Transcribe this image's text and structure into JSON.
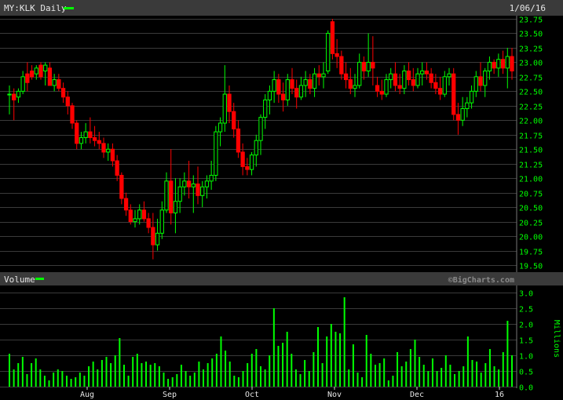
{
  "header": {
    "symbol_label": "MY:KLK Daily",
    "date": "1/06/16"
  },
  "volume_panel": {
    "label": "Volume",
    "unit_label": "Millions",
    "watermark": "©BigCharts.com"
  },
  "colors": {
    "up": "#00ff00",
    "down": "#ff0000",
    "background": "#000000",
    "grid": "#3a3a3a"
  },
  "chart_data": [
    {
      "type": "candlestick",
      "title": "MY:KLK Daily",
      "ylim": [
        19.5,
        23.75
      ],
      "y_ticks": [
        "23.75",
        "23.50",
        "23.25",
        "23.00",
        "22.75",
        "22.50",
        "22.25",
        "22.00",
        "21.75",
        "21.50",
        "21.25",
        "21.00",
        "20.75",
        "20.50",
        "20.25",
        "20.00",
        "19.75",
        "19.50"
      ],
      "x_ticks": [
        "Aug",
        "Sep",
        "Oct",
        "Nov",
        "Dec",
        "16"
      ],
      "grid": true,
      "ohlc": [
        [
          22.45,
          22.6,
          22.1,
          22.45
        ],
        [
          22.45,
          22.55,
          22.0,
          22.35
        ],
        [
          22.4,
          22.55,
          22.3,
          22.5
        ],
        [
          22.5,
          22.85,
          22.45,
          22.75
        ],
        [
          22.8,
          23.0,
          22.5,
          22.65
        ],
        [
          22.85,
          22.95,
          22.7,
          22.75
        ],
        [
          22.8,
          22.95,
          22.7,
          22.9
        ],
        [
          22.95,
          23.0,
          22.7,
          22.75
        ],
        [
          22.85,
          23.0,
          22.6,
          22.95
        ],
        [
          22.9,
          23.0,
          22.7,
          22.6
        ],
        [
          22.6,
          22.8,
          22.5,
          22.7
        ],
        [
          22.7,
          22.8,
          22.5,
          22.55
        ],
        [
          22.55,
          22.65,
          22.3,
          22.4
        ],
        [
          22.4,
          22.5,
          22.1,
          22.25
        ],
        [
          22.25,
          22.3,
          21.85,
          21.95
        ],
        [
          21.95,
          22.0,
          21.5,
          21.6
        ],
        [
          21.6,
          21.8,
          21.5,
          21.7
        ],
        [
          21.7,
          21.95,
          21.6,
          21.8
        ],
        [
          21.8,
          22.05,
          21.6,
          21.7
        ],
        [
          21.7,
          21.9,
          21.55,
          21.65
        ],
        [
          21.65,
          21.8,
          21.5,
          21.6
        ],
        [
          21.6,
          21.7,
          21.35,
          21.45
        ],
        [
          21.45,
          21.6,
          21.3,
          21.5
        ],
        [
          21.5,
          21.6,
          21.2,
          21.3
        ],
        [
          21.3,
          21.4,
          20.95,
          21.05
        ],
        [
          21.05,
          21.1,
          20.55,
          20.65
        ],
        [
          20.65,
          20.75,
          20.35,
          20.45
        ],
        [
          20.45,
          20.55,
          20.2,
          20.25
        ],
        [
          20.25,
          20.45,
          20.15,
          20.3
        ],
        [
          20.3,
          20.55,
          20.2,
          20.45
        ],
        [
          20.45,
          20.6,
          20.25,
          20.3
        ],
        [
          20.3,
          20.4,
          20.05,
          20.15
        ],
        [
          20.15,
          20.4,
          19.6,
          19.85
        ],
        [
          19.85,
          20.3,
          19.75,
          20.05
        ],
        [
          20.05,
          20.6,
          19.95,
          20.45
        ],
        [
          20.45,
          21.1,
          20.4,
          20.95
        ],
        [
          20.95,
          21.5,
          20.2,
          20.4
        ],
        [
          20.4,
          21.0,
          20.05,
          20.6
        ],
        [
          20.6,
          21.0,
          20.4,
          20.85
        ],
        [
          20.85,
          21.1,
          20.7,
          20.95
        ],
        [
          20.95,
          21.3,
          20.65,
          20.85
        ],
        [
          20.85,
          21.05,
          20.4,
          20.9
        ],
        [
          20.9,
          21.2,
          20.55,
          20.7
        ],
        [
          20.7,
          20.95,
          20.5,
          20.85
        ],
        [
          20.85,
          21.05,
          20.65,
          20.95
        ],
        [
          20.95,
          21.3,
          20.8,
          21.05
        ],
        [
          21.05,
          21.9,
          20.95,
          21.8
        ],
        [
          21.8,
          22.05,
          21.55,
          21.95
        ],
        [
          21.95,
          22.95,
          21.8,
          22.45
        ],
        [
          22.45,
          22.6,
          21.95,
          22.15
        ],
        [
          22.15,
          22.3,
          21.7,
          21.85
        ],
        [
          21.85,
          22.0,
          21.35,
          21.45
        ],
        [
          21.45,
          21.6,
          21.05,
          21.2
        ],
        [
          21.2,
          21.35,
          21.05,
          21.15
        ],
        [
          21.15,
          21.45,
          21.05,
          21.4
        ],
        [
          21.4,
          21.75,
          21.2,
          21.65
        ],
        [
          21.65,
          22.1,
          21.4,
          22.05
        ],
        [
          22.05,
          22.45,
          21.85,
          22.35
        ],
        [
          22.35,
          22.6,
          22.1,
          22.5
        ],
        [
          22.5,
          22.85,
          22.3,
          22.7
        ],
        [
          22.7,
          22.8,
          22.3,
          22.45
        ],
        [
          22.45,
          22.65,
          22.15,
          22.35
        ],
        [
          22.35,
          22.8,
          22.25,
          22.7
        ],
        [
          22.7,
          22.9,
          22.45,
          22.55
        ],
        [
          22.55,
          22.7,
          22.2,
          22.4
        ],
        [
          22.4,
          22.75,
          22.35,
          22.6
        ],
        [
          22.6,
          22.85,
          22.4,
          22.7
        ],
        [
          22.7,
          22.8,
          22.45,
          22.55
        ],
        [
          22.55,
          22.9,
          22.4,
          22.8
        ],
        [
          22.8,
          22.95,
          22.6,
          22.75
        ],
        [
          22.75,
          23.0,
          22.55,
          22.8
        ],
        [
          22.85,
          23.55,
          22.8,
          23.5
        ],
        [
          23.7,
          23.75,
          23.05,
          23.15
        ],
        [
          23.15,
          23.4,
          22.9,
          23.1
        ],
        [
          23.1,
          23.2,
          22.7,
          22.8
        ],
        [
          22.8,
          23.0,
          22.55,
          22.7
        ],
        [
          22.7,
          22.9,
          22.45,
          22.55
        ],
        [
          22.55,
          22.8,
          22.4,
          22.6
        ],
        [
          22.6,
          23.15,
          22.55,
          23.0
        ],
        [
          23.0,
          23.1,
          22.7,
          22.85
        ],
        [
          22.85,
          23.5,
          22.75,
          23.0
        ],
        [
          23.0,
          23.45,
          22.6,
          22.9
        ],
        [
          22.6,
          22.75,
          22.4,
          22.5
        ],
        [
          22.5,
          22.7,
          22.35,
          22.45
        ],
        [
          22.45,
          22.8,
          22.4,
          22.7
        ],
        [
          22.7,
          22.9,
          22.55,
          22.8
        ],
        [
          22.8,
          23.0,
          22.5,
          22.6
        ],
        [
          22.6,
          22.8,
          22.45,
          22.55
        ],
        [
          22.55,
          22.95,
          22.45,
          22.85
        ],
        [
          22.85,
          23.0,
          22.6,
          22.7
        ],
        [
          22.7,
          22.9,
          22.5,
          22.6
        ],
        [
          22.6,
          22.9,
          22.55,
          22.8
        ],
        [
          22.8,
          23.0,
          22.6,
          22.85
        ],
        [
          22.85,
          23.0,
          22.7,
          22.8
        ],
        [
          22.8,
          22.9,
          22.55,
          22.65
        ],
        [
          22.65,
          22.8,
          22.45,
          22.55
        ],
        [
          22.55,
          22.75,
          22.35,
          22.45
        ],
        [
          22.45,
          22.85,
          22.4,
          22.75
        ],
        [
          22.75,
          22.9,
          22.6,
          22.8
        ],
        [
          22.8,
          22.9,
          22.0,
          22.1
        ],
        [
          22.1,
          22.3,
          21.75,
          22.0
        ],
        [
          22.0,
          22.4,
          21.9,
          22.2
        ],
        [
          22.2,
          22.4,
          22.05,
          22.3
        ],
        [
          22.3,
          22.6,
          22.2,
          22.5
        ],
        [
          22.5,
          22.85,
          22.4,
          22.75
        ],
        [
          22.75,
          23.0,
          22.5,
          22.6
        ],
        [
          22.6,
          22.9,
          22.4,
          22.85
        ],
        [
          22.85,
          23.1,
          22.7,
          23.0
        ],
        [
          23.0,
          23.05,
          22.8,
          22.9
        ],
        [
          22.9,
          23.15,
          22.75,
          23.05
        ],
        [
          23.05,
          23.2,
          22.8,
          22.9
        ],
        [
          22.9,
          23.25,
          22.55,
          23.1
        ],
        [
          23.1,
          23.25,
          22.7,
          22.85
        ]
      ]
    },
    {
      "type": "bar",
      "title": "Volume",
      "ylabel": "Millions",
      "ylim": [
        0,
        3.0
      ],
      "y_ticks": [
        "3.0",
        "2.5",
        "2.0",
        "1.5",
        "1.0",
        "0.5",
        "0.0"
      ],
      "values": [
        1.05,
        0.55,
        0.75,
        0.95,
        0.4,
        0.75,
        0.9,
        0.55,
        0.35,
        0.2,
        0.45,
        0.55,
        0.5,
        0.35,
        0.25,
        0.3,
        0.45,
        0.35,
        0.65,
        0.8,
        0.55,
        0.85,
        0.95,
        0.75,
        1.0,
        1.55,
        0.7,
        0.35,
        0.95,
        1.05,
        0.75,
        0.8,
        0.7,
        0.75,
        0.65,
        0.45,
        0.25,
        0.3,
        0.4,
        0.7,
        0.5,
        0.35,
        0.45,
        0.8,
        0.55,
        0.75,
        0.9,
        1.05,
        1.6,
        1.15,
        0.8,
        0.35,
        0.3,
        0.5,
        0.75,
        1.05,
        1.2,
        0.65,
        0.55,
        1.0,
        2.5,
        1.3,
        1.4,
        1.75,
        1.05,
        0.55,
        0.4,
        0.85,
        0.5,
        1.1,
        1.9,
        0.75,
        1.6,
        2.0,
        1.75,
        1.7,
        2.85,
        0.55,
        1.35,
        0.45,
        0.3,
        1.65,
        1.05,
        0.7,
        0.75,
        0.9,
        0.2,
        0.35,
        1.1,
        0.65,
        0.8,
        1.2,
        1.5,
        0.95,
        0.7,
        0.5,
        0.9,
        0.5,
        0.6,
        1.0,
        0.7,
        0.4,
        0.5,
        0.65,
        1.6,
        0.85,
        0.8,
        0.45,
        0.75,
        1.2,
        0.65,
        0.55,
        1.1,
        2.1,
        1.0
      ]
    }
  ]
}
